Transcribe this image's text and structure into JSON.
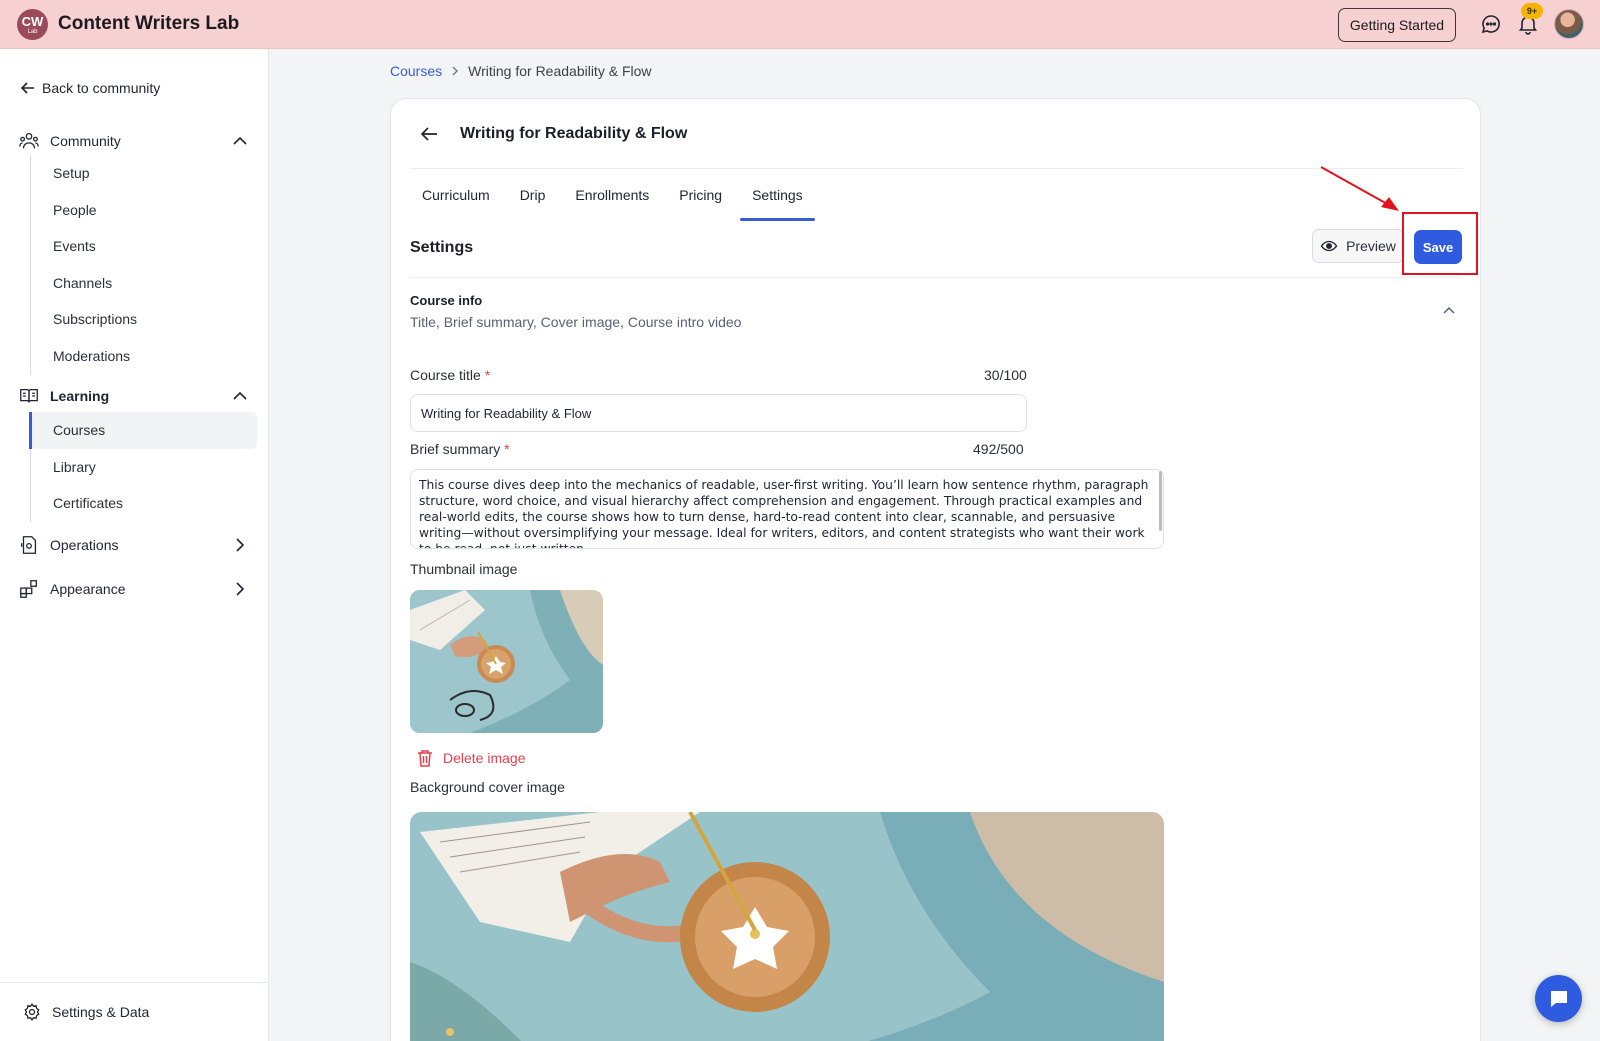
{
  "app": {
    "logo_text": "CW",
    "logo_subtext": "Lab",
    "name": "Content Writers Lab",
    "getting_started_label": "Getting Started",
    "notification_count": "9+"
  },
  "sidebar": {
    "back_label": "Back to community",
    "sections": [
      {
        "label": "Community",
        "icon": "community-icon",
        "expanded": true,
        "items": [
          "Setup",
          "People",
          "Events",
          "Channels",
          "Subscriptions",
          "Moderations"
        ]
      },
      {
        "label": "Learning",
        "icon": "book-icon",
        "expanded": true,
        "items": [
          "Courses",
          "Library",
          "Certificates"
        ],
        "active_item": "Courses"
      },
      {
        "label": "Operations",
        "icon": "operations-icon",
        "expanded": false
      },
      {
        "label": "Appearance",
        "icon": "appearance-icon",
        "expanded": false
      }
    ],
    "footer_label": "Settings & Data"
  },
  "breadcrumb": {
    "root": "Courses",
    "current": "Writing for Readability & Flow"
  },
  "course": {
    "title": "Writing for Readability & Flow",
    "tabs": [
      "Curriculum",
      "Drip",
      "Enrollments",
      "Pricing",
      "Settings"
    ],
    "active_tab": "Settings"
  },
  "settings": {
    "title": "Settings",
    "preview_label": "Preview",
    "save_label": "Save",
    "section_title": "Course info",
    "section_subtitle": "Title, Brief summary, Cover image, Course intro video",
    "course_title_label": "Course title",
    "course_title_counter": "30/100",
    "course_title_value": "Writing for Readability & Flow",
    "summary_label": "Brief summary",
    "summary_counter": "492/500",
    "summary_value": "This course dives deep into the mechanics of readable, user-first writing. You’ll learn how sentence rhythm, paragraph structure, word choice, and visual hierarchy affect comprehension and engagement. Through practical examples and real-world edits, the course shows how to turn dense, hard-to-read content into clear, scannable, and persuasive writing—without oversimplifying your message. Ideal for writers, editors, and content strategists who want their work to be read, not just written.",
    "thumbnail_label": "Thumbnail image",
    "delete_image_label": "Delete image",
    "cover_label": "Background cover image"
  },
  "colors": {
    "topbar": "#f7d0d2",
    "accent": "#2f5be0",
    "danger": "#e0404f",
    "highlight": "#e0141e"
  }
}
